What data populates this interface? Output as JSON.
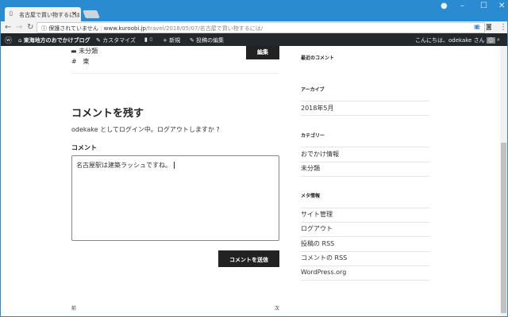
{
  "browser": {
    "tab_title": "名古屋で買い物するには –",
    "url_warning": "保護されていません",
    "url_host": "www.kuroobi.jp",
    "url_path": "/travel/2018/05/07/名古屋で買い物するには/"
  },
  "admin_bar": {
    "site": "東海地方のおでかけブログ",
    "customize": "カスタマイズ",
    "comments_count": "0",
    "new": "新規",
    "edit_post": "投稿の編集",
    "greeting": "こんにちは、odekake さん"
  },
  "post": {
    "category": "未分類",
    "tag": "東",
    "edit_label": "編集"
  },
  "comment_form": {
    "heading": "コメントを残す",
    "logged_in_text": "odekake としてログイン中。ログアウトしますか ?",
    "label": "コメント",
    "value": "名古屋駅は建築ラッシュですね。",
    "submit_label": "コメントを送信"
  },
  "post_nav": {
    "prev": "前",
    "next": "次"
  },
  "sidebar": {
    "recent_comments_title": "最近のコメント",
    "archive_title": "アーカイブ",
    "archives": [
      "2018年5月"
    ],
    "categories_title": "カテゴリー",
    "categories": [
      "おでかけ情報",
      "未分類"
    ],
    "meta_title": "メタ情報",
    "meta": [
      "サイト管理",
      "ログアウト",
      "投稿の RSS",
      "コメントの RSS",
      "WordPress.org"
    ]
  }
}
